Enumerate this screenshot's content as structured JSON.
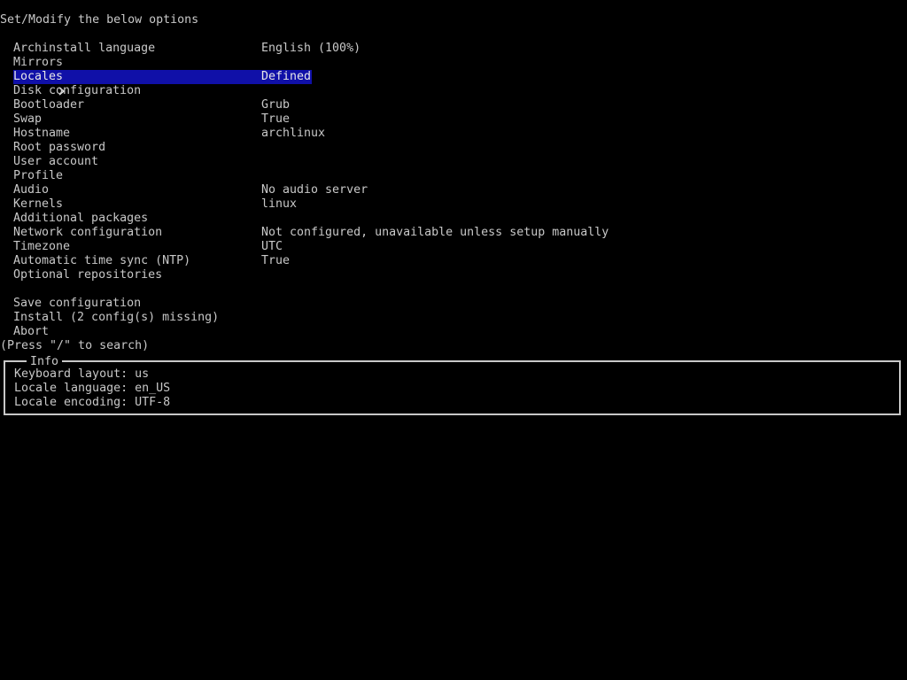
{
  "header": {
    "title": "Set/Modify the below options"
  },
  "cursor_glyph": ">",
  "menu": {
    "selected_index": 2,
    "items": [
      {
        "label": "Archinstall language",
        "value": "English (100%)"
      },
      {
        "label": "Mirrors",
        "value": ""
      },
      {
        "label": "Locales",
        "value": "Defined"
      },
      {
        "label": "Disk configuration",
        "value": ""
      },
      {
        "label": "Bootloader",
        "value": "Grub"
      },
      {
        "label": "Swap",
        "value": "True"
      },
      {
        "label": "Hostname",
        "value": "archlinux"
      },
      {
        "label": "Root password",
        "value": ""
      },
      {
        "label": "User account",
        "value": ""
      },
      {
        "label": "Profile",
        "value": ""
      },
      {
        "label": "Audio",
        "value": "No audio server"
      },
      {
        "label": "Kernels",
        "value": "linux"
      },
      {
        "label": "Additional packages",
        "value": ""
      },
      {
        "label": "Network configuration",
        "value": "Not configured, unavailable unless setup manually"
      },
      {
        "label": "Timezone",
        "value": "UTC"
      },
      {
        "label": "Automatic time sync (NTP)",
        "value": "True"
      },
      {
        "label": "Optional repositories",
        "value": ""
      }
    ],
    "actions": [
      {
        "label": "Save configuration"
      },
      {
        "label": "Install (2 config(s) missing)"
      },
      {
        "label": "Abort"
      }
    ]
  },
  "search_hint": "(Press \"/\" to search)",
  "info": {
    "title": "Info",
    "lines": [
      "Keyboard layout: us",
      "Locale language: en_US",
      "Locale encoding: UTF-8"
    ]
  },
  "colors": {
    "background": "#000000",
    "text": "#c8c8c8",
    "selection": "#1010a8"
  }
}
